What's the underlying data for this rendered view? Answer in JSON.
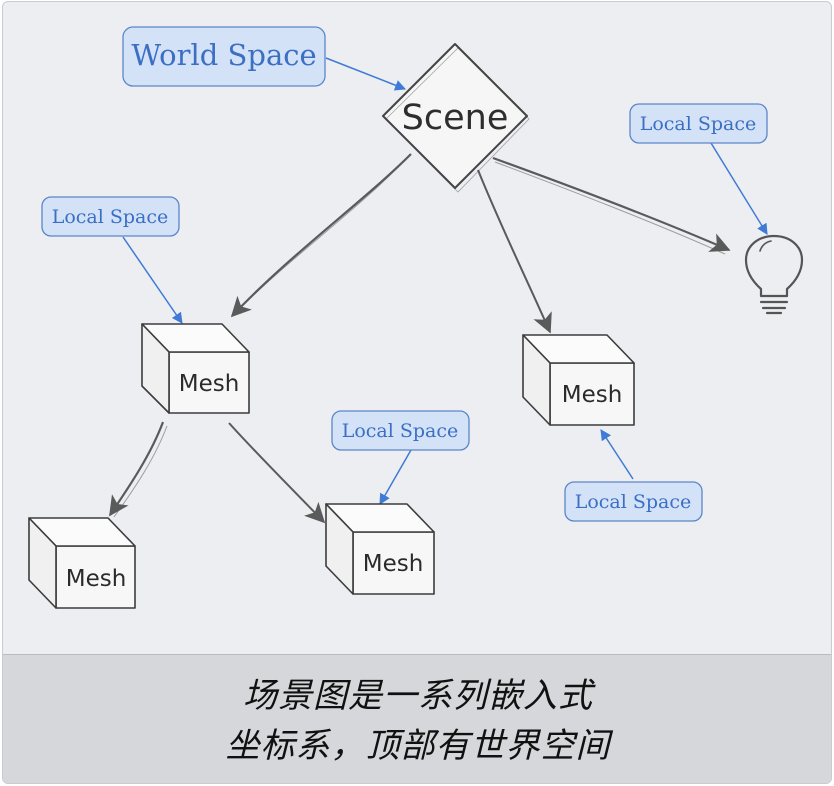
{
  "nodes": {
    "scene": "Scene",
    "world_space": "World Space",
    "local_space_label": "Local Space",
    "mesh_label": "Mesh"
  },
  "caption": {
    "line1": "场景图是一系列嵌入式",
    "line2": "坐标系，顶部有世界空间"
  },
  "colors": {
    "tag_fill": "#d3e2f7",
    "tag_text": "#3a6fc4",
    "arrow_gray": "#5a5a5a",
    "arrow_blue": "#3f7ad6",
    "background": "#eceef2",
    "caption_bg": "#d6d7da"
  }
}
